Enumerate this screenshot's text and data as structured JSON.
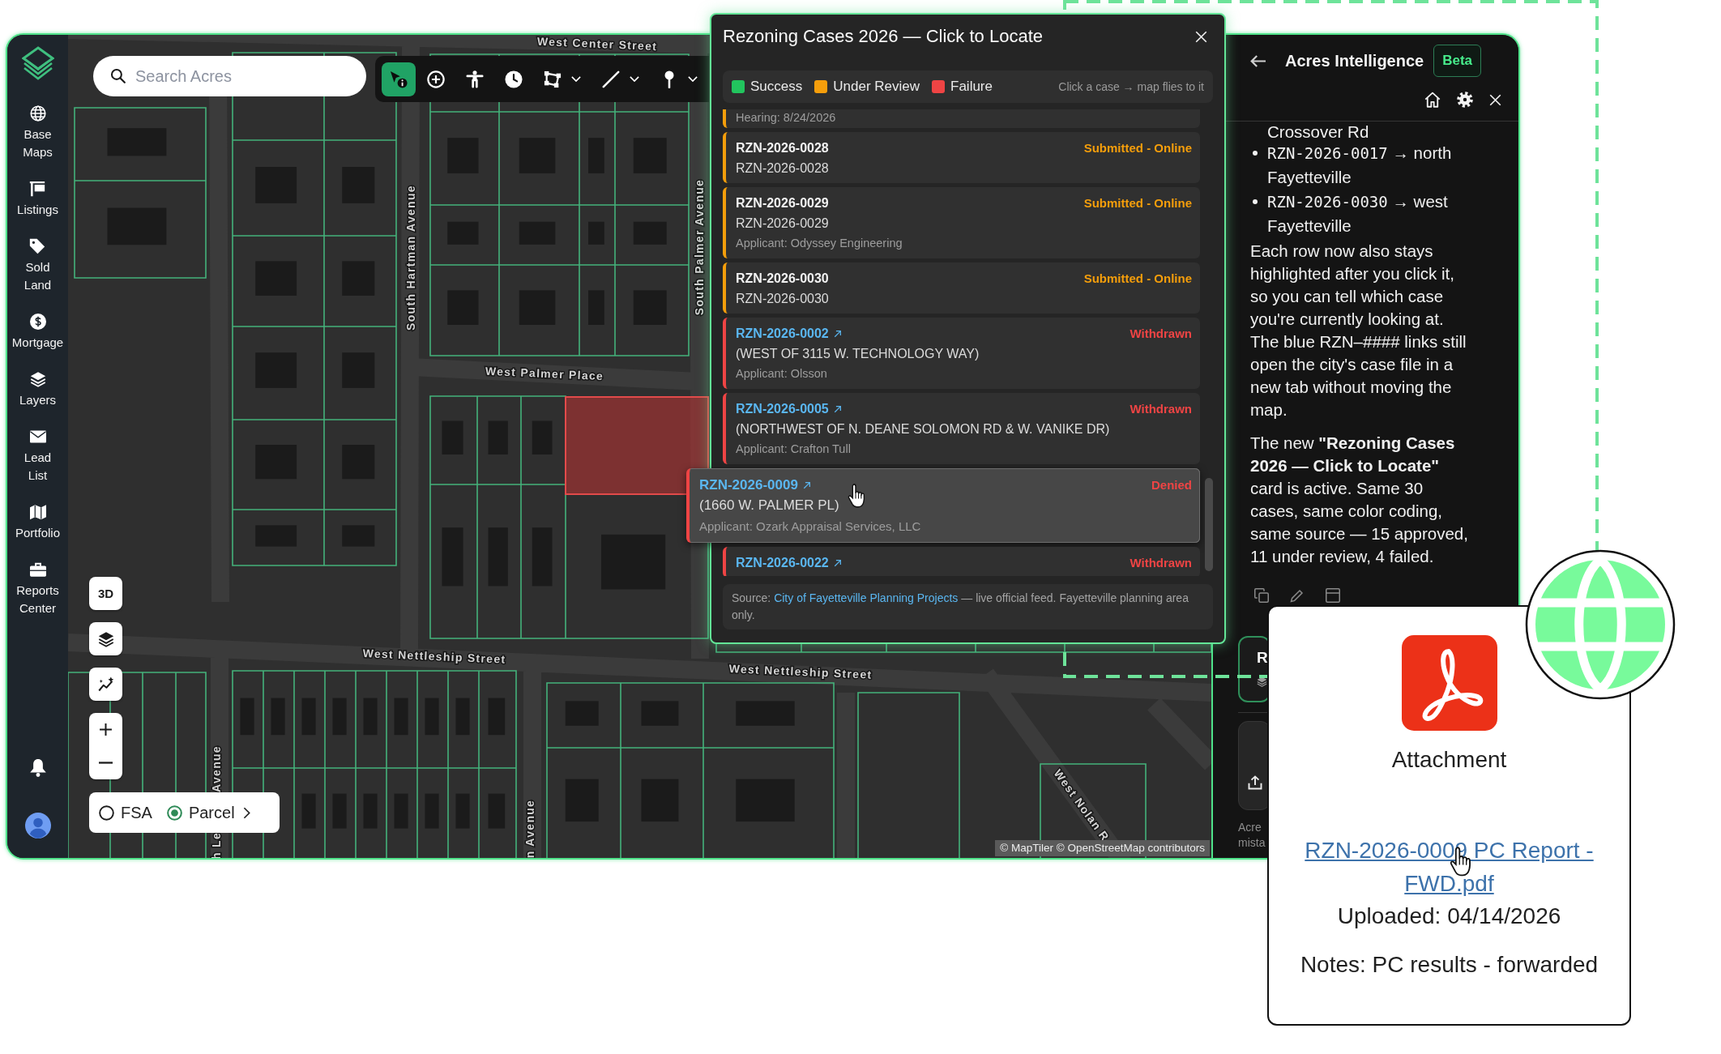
{
  "sidebar": {
    "items": [
      {
        "kind": "globe",
        "label": "Base Maps"
      },
      {
        "kind": "flag",
        "label": "Listings"
      },
      {
        "kind": "tag",
        "label": "Sold Land"
      },
      {
        "kind": "dollar",
        "label": "Mortgage"
      },
      {
        "kind": "layers",
        "label": "Layers"
      },
      {
        "kind": "envelope",
        "label": "Lead List"
      },
      {
        "kind": "map",
        "label": "Portfolio"
      },
      {
        "kind": "briefcase",
        "label": "Reports Center"
      }
    ]
  },
  "search": {
    "placeholder": "Search Acres"
  },
  "toolbar": {
    "tools": [
      {
        "kind": "select-info",
        "selected": true,
        "dropdown": false
      },
      {
        "kind": "add",
        "selected": false,
        "dropdown": false
      },
      {
        "kind": "person",
        "selected": false,
        "dropdown": false
      },
      {
        "kind": "clock",
        "selected": false,
        "dropdown": false
      },
      {
        "kind": "polygon",
        "selected": false,
        "dropdown": true
      },
      {
        "kind": "line",
        "selected": false,
        "dropdown": true
      },
      {
        "kind": "pin",
        "selected": false,
        "dropdown": true
      }
    ]
  },
  "map": {
    "street_labels": [
      "West Center Street",
      "South Hartman Avenue",
      "West Palmer Place",
      "South Palmer Avenue",
      "West Nettleship Street",
      "West Nettleship Street",
      "Avenue",
      "h Le",
      "n Avenue",
      "West Nolan R"
    ],
    "attribution": "© MapTiler © OpenStreetMap contributors"
  },
  "map_controls": {
    "buttons": [
      {
        "kind": "text",
        "label": "3D"
      },
      {
        "kind": "layers"
      },
      {
        "kind": "trend"
      }
    ],
    "layer_toggle": {
      "options": [
        {
          "label": "FSA",
          "selected": false
        },
        {
          "label": "Parcel",
          "selected": true
        }
      ]
    }
  },
  "rezoning_card": {
    "title": "Rezoning Cases 2026 — Click to Locate",
    "legend": [
      {
        "label": "Success",
        "color": "#22c55e"
      },
      {
        "label": "Under Review",
        "color": "#f59e0b"
      },
      {
        "label": "Failure",
        "color": "#ef4444"
      }
    ],
    "hint": "Click a case → map flies to it",
    "rows": [
      {
        "lines": [
          {
            "kind": "meta",
            "text": "Hearing: 8/24/2026"
          }
        ],
        "color": "#f59e0b",
        "selected": false
      },
      {
        "id": "RZN-2026-0028",
        "link": false,
        "status": "Submitted - Online",
        "lines": [
          {
            "kind": "address",
            "text": "RZN-2026-0028"
          }
        ],
        "color": "#f59e0b",
        "selected": false
      },
      {
        "id": "RZN-2026-0029",
        "link": false,
        "status": "Submitted - Online",
        "lines": [
          {
            "kind": "address",
            "text": "RZN-2026-0029"
          },
          {
            "kind": "meta",
            "text": "Applicant: Odyssey Engineering"
          }
        ],
        "color": "#f59e0b",
        "selected": false
      },
      {
        "id": "RZN-2026-0030",
        "link": false,
        "status": "Submitted - Online",
        "lines": [
          {
            "kind": "address",
            "text": "RZN-2026-0030"
          }
        ],
        "color": "#f59e0b",
        "selected": false
      },
      {
        "id": "RZN-2026-0002",
        "link": true,
        "status": "Withdrawn",
        "lines": [
          {
            "kind": "address",
            "text": "(WEST OF 3115 W. TECHNOLOGY WAY)"
          },
          {
            "kind": "meta",
            "text": "Applicant: Olsson"
          }
        ],
        "color": "#ef4444",
        "selected": false
      },
      {
        "id": "RZN-2026-0005",
        "link": true,
        "status": "Withdrawn",
        "lines": [
          {
            "kind": "address",
            "text": "(NORTHWEST OF N. DEANE SOLOMON RD & W. VANIKE DR)"
          },
          {
            "kind": "meta",
            "text": "Applicant: Crafton Tull"
          }
        ],
        "color": "#ef4444",
        "selected": false
      },
      {
        "id": "RZN-2026-0009",
        "link": true,
        "status": "Denied",
        "lines": [
          {
            "kind": "address",
            "text": "(1660 W. PALMER PL)"
          },
          {
            "kind": "meta",
            "text": "Applicant: Ozark Appraisal Services, LLC"
          }
        ],
        "color": "#ef4444",
        "selected": true
      },
      {
        "id": "RZN-2026-0022",
        "link": true,
        "status": "Withdrawn",
        "color": "#ef4444",
        "selected": false
      }
    ],
    "source": {
      "prefix": "Source:",
      "link": "City of Fayetteville Planning Projects",
      "suffix": "— live official feed. Fayetteville planning area only."
    }
  },
  "assistant": {
    "title": "Acres Intelligence",
    "badge": "Beta",
    "continued": "Crossover Rd",
    "bullets": [
      {
        "code": "RZN-2026-0017",
        "text": "→ north Fayetteville"
      },
      {
        "code": "RZN-2026-0030",
        "text": "→ west Fayetteville"
      }
    ],
    "paragraphs": [
      "Each row now also stays highlighted after you click it, so you can tell which case you're currently looking at. The blue RZN–#### links still open the city's case file in a new tab without moving the map.",
      "The new **\"Rezoning Cases 2026 — Click to Locate\"** card is active. Same 30 cases, same color coding, same source — 15 approved, 11 under review, 4 failed."
    ],
    "button_text": "R",
    "note_lines": [
      "Acre",
      "mista"
    ]
  },
  "attachment": {
    "title": "Attachment",
    "file": "RZN-2026-0009 PC Report - FWD.pdf",
    "uploaded": "Uploaded: 04/14/2026",
    "notes": "Notes: PC results - forwarded"
  }
}
